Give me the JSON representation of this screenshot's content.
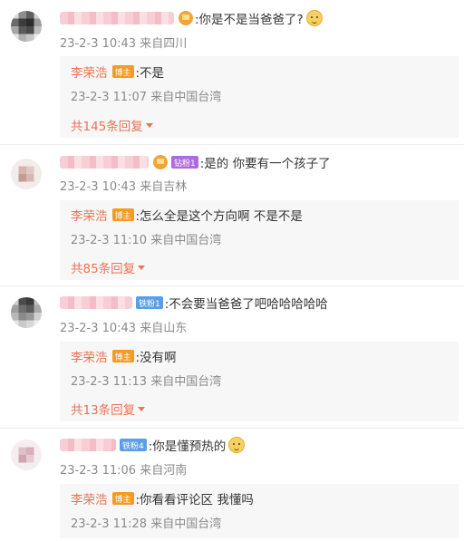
{
  "comments": [
    {
      "text": ":你是不是当爸爸了?",
      "meta": "23-2-3 10:43 来自四川",
      "reply": {
        "author": "李荣浩",
        "host_badge": "博主",
        "text": ":不是",
        "meta": "23-2-3 11:07 来自中国台湾"
      },
      "more": "共145条回复",
      "fan_badge": ""
    },
    {
      "text": ":是的 你要有一个孩子了",
      "meta": "23-2-3 10:43 来自吉林",
      "reply": {
        "author": "李荣浩",
        "host_badge": "博主",
        "text": ":怎么全是这个方向啊 不是不是",
        "meta": "23-2-3 11:10 来自中国台湾"
      },
      "more": "共85条回复",
      "fan_badge": "钻粉1"
    },
    {
      "text": ":不会要当爸爸了吧哈哈哈哈哈",
      "meta": "23-2-3 10:43 来自山东",
      "reply": {
        "author": "李荣浩",
        "host_badge": "博主",
        "text": ":没有啊",
        "meta": "23-2-3 11:13 来自中国台湾"
      },
      "more": "共13条回复",
      "fan_badge": "铁粉1"
    },
    {
      "text": ":你是懂预热的",
      "meta": "23-2-3 11:06 来自河南",
      "reply": {
        "author": "李荣浩",
        "host_badge": "博主",
        "text": ":你看看评论区 我懂吗",
        "meta": "23-2-3 11:28 来自中国台湾"
      },
      "more": "",
      "fan_badge": "铁粉4"
    }
  ],
  "colors": {
    "accent": "#eb7350",
    "host_badge": "#f59a23",
    "meta": "#8a8a8a"
  },
  "icons": {
    "emoji": "doge-emoji-icon",
    "crown": "crown-badge-icon",
    "caret": "caret-down-icon"
  }
}
